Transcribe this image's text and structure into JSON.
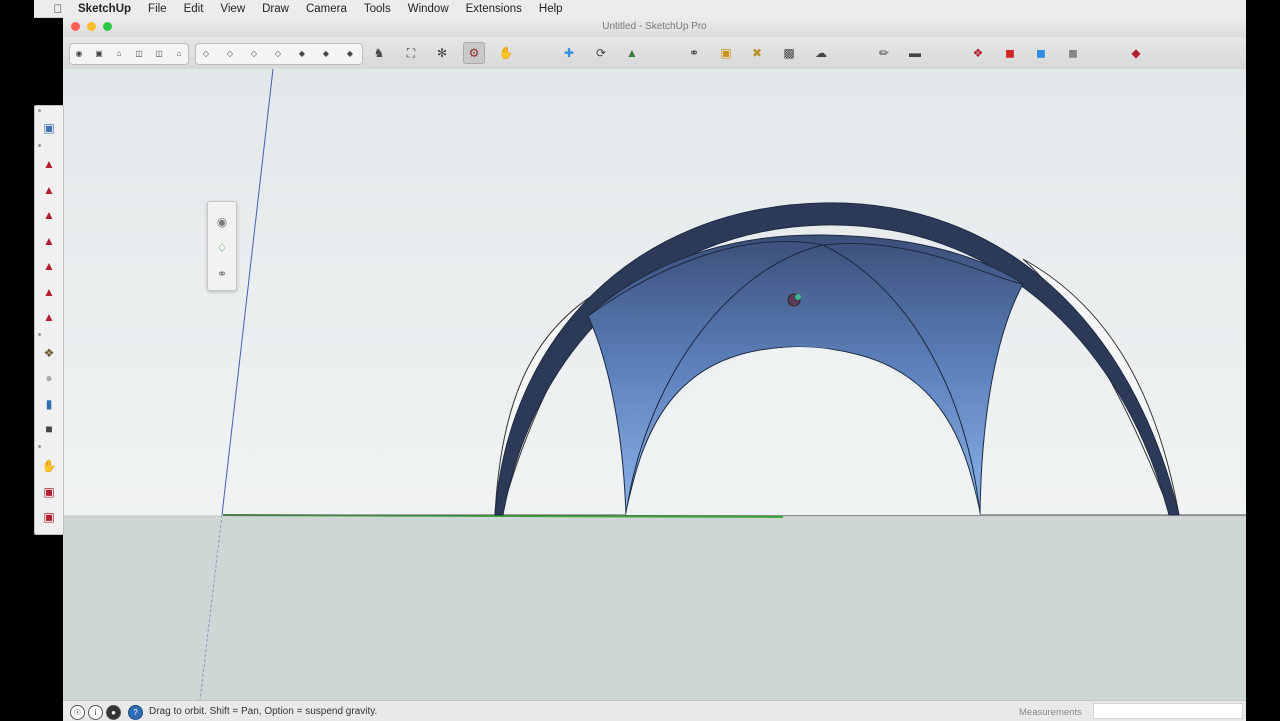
{
  "menubar": {
    "apple_icon": "apple-logo-icon",
    "items": [
      "SketchUp",
      "File",
      "Edit",
      "View",
      "Draw",
      "Camera",
      "Tools",
      "Window",
      "Extensions",
      "Help"
    ]
  },
  "window": {
    "title": "Untitled - SketchUp Pro",
    "traffic_lights": {
      "close": "#fc5f57",
      "minimize": "#fdbc2e",
      "zoom": "#28c840"
    }
  },
  "toolbar": {
    "standard_views": [
      "iso-view-icon",
      "top-view-icon",
      "front-view-icon",
      "right-view-icon",
      "back-view-icon",
      "left-view-icon"
    ],
    "styles": [
      "xray-icon",
      "back-edges-icon",
      "wireframe-icon",
      "hidden-line-icon",
      "shaded-icon",
      "shaded-textures-icon",
      "monochrome-icon"
    ],
    "tools": [
      "camera-position-icon",
      "look-around-icon",
      "walk-icon",
      "orbit-icon",
      "pan-icon",
      "axes-icon",
      "section-plane-icon",
      "3d-text-icon",
      "sandbox-icon",
      "component-icon",
      "paint-bucket-icon",
      "match-photo-icon",
      "shadows-icon",
      "tape-measure-icon",
      "eraser-icon",
      "warehouse-icon",
      "extension-warehouse-icon",
      "layout-icon",
      "style-builder-icon",
      "ruby-console-icon"
    ],
    "active_tool": "orbit-icon"
  },
  "left_palette": {
    "tools": [
      "select-icon",
      "push-pull-icon",
      "move-icon",
      "rotate-icon",
      "scale-icon",
      "offset-icon",
      "follow-me-icon",
      "tape-icon",
      "protractor-icon",
      "dimension-icon",
      "text-icon",
      "axes-tool-icon",
      "3d-warehouse-icon",
      "extension-icon",
      "components-icon",
      "ruby-icon"
    ]
  },
  "float_palette": {
    "tools": [
      "walk-icon",
      "position-camera-icon",
      "look-around-icon"
    ]
  },
  "colors": {
    "sky": "#e9eef0",
    "ground": "#cdd4d4",
    "dome_dark": "#2b3b5c",
    "dome_light": "#7fa8dd",
    "axis_blue": "#4a5bb3",
    "axis_green": "#3aa93a"
  },
  "status": {
    "text": "Drag to orbit. Shift = Pan, Option = suspend gravity.",
    "measurements_label": "Measurements",
    "measurements_value": ""
  }
}
